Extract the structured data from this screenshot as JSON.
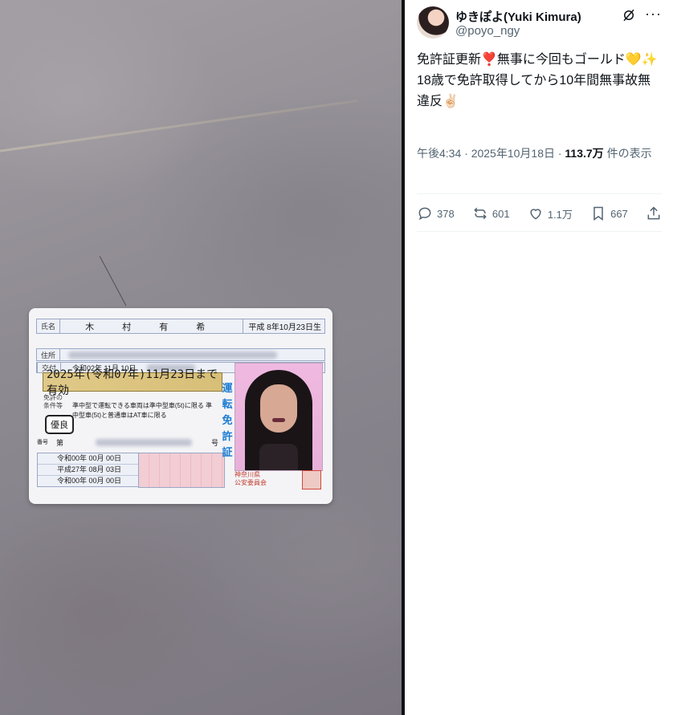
{
  "photo": {
    "card": {
      "name_label": "氏名",
      "name": "木 村 有 希",
      "birth": "平成 8年10月23日生",
      "address_label": "住所",
      "issue_label": "交付",
      "issue_date": "令和02年 11月 10日",
      "expiry": "2025年(令和07年)11月23日まで有効",
      "conditions_label": "免許の条件等",
      "conditions_text": "準中型で運転できる車両は準中型車(5t)に限る 準中型車(5t)と普通車はAT車に限る",
      "yuryo": "優良",
      "number_label": "番号",
      "number_prefix": "第",
      "number_suffix": "号",
      "dates": [
        "令和00年 00月 00日",
        "平成27年 08月 03日",
        "令和00年 00月 00日"
      ],
      "vertical_title": "運転免許証",
      "prefecture": "神奈川県",
      "commission": "公安委員会"
    }
  },
  "tweet": {
    "display_name": "ゆきぽよ(Yuki Kimura)",
    "handle": "@poyo_ngy",
    "line1": "免許証更新❣️無事に今回もゴールド💛✨",
    "line2": "18歳で免許取得してから10年間無事故無違反✌🏻",
    "time": "午後4:34 · 2025年10月18日 · ",
    "views": "113.7万",
    "views_suffix": " 件の表示",
    "replies": "378",
    "reposts": "601",
    "likes": "1.1万",
    "bookmarks": "667"
  }
}
